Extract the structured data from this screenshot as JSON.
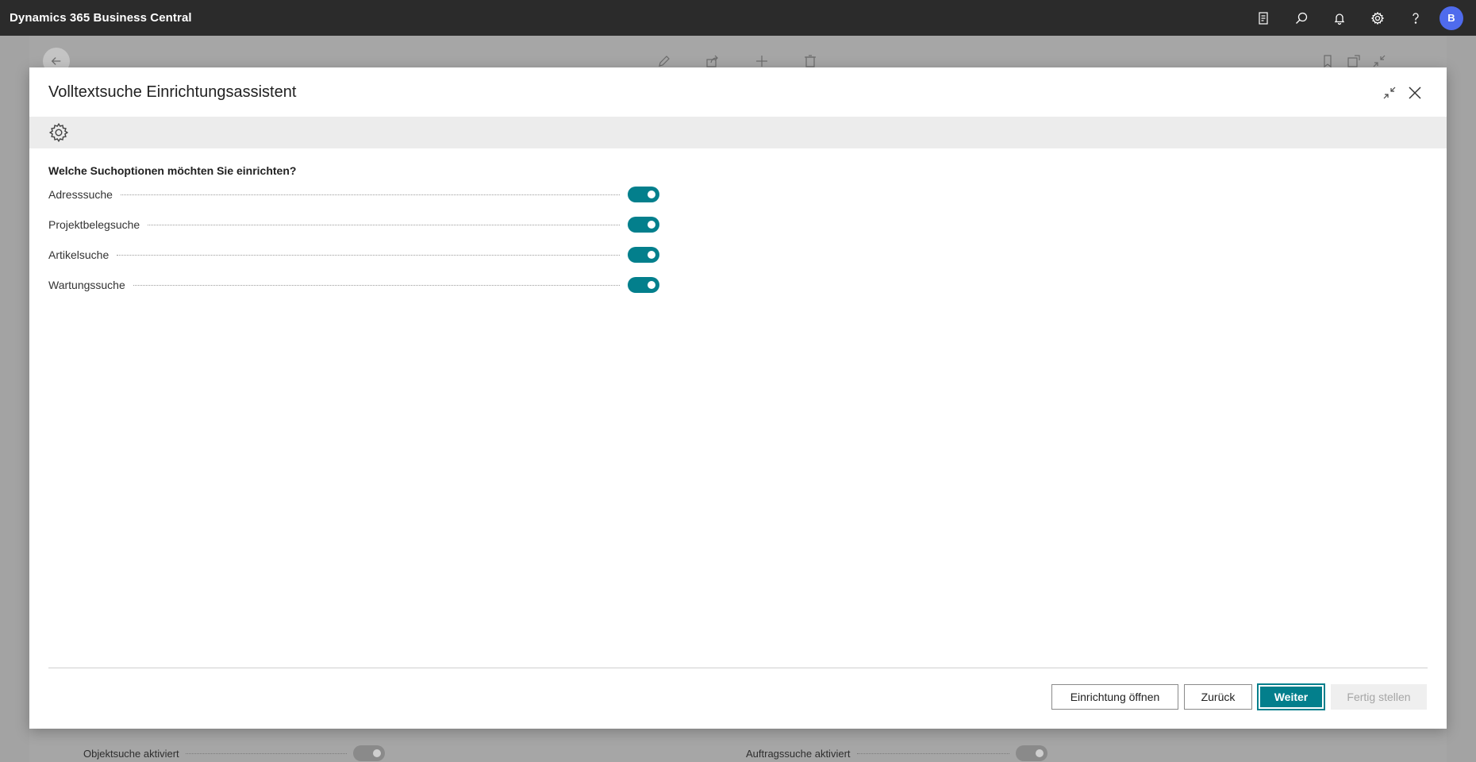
{
  "app": {
    "title": "Dynamics 365 Business Central",
    "user_initial": "B",
    "icons": [
      "document-icon",
      "search-icon",
      "bell-icon",
      "gear-icon",
      "help-icon"
    ]
  },
  "background_page": {
    "bottom_fields": [
      {
        "label": "Objektsuche aktiviert",
        "enabled": true
      },
      {
        "label": "Auftragssuche aktiviert",
        "enabled": true
      }
    ]
  },
  "dialog": {
    "title": "Volltextsuche Einrichtungsassistent",
    "question": "Welche Suchoptionen möchten Sie einrichten?",
    "options": [
      {
        "label": "Adresssuche",
        "enabled": true
      },
      {
        "label": "Projektbelegsuche",
        "enabled": true
      },
      {
        "label": "Artikelsuche",
        "enabled": true
      },
      {
        "label": "Wartungssuche",
        "enabled": true
      }
    ],
    "buttons": {
      "open_setup": "Einrichtung öffnen",
      "back": "Zurück",
      "next": "Weiter",
      "finish": "Fertig stellen"
    },
    "accent_color": "#037f8c"
  }
}
